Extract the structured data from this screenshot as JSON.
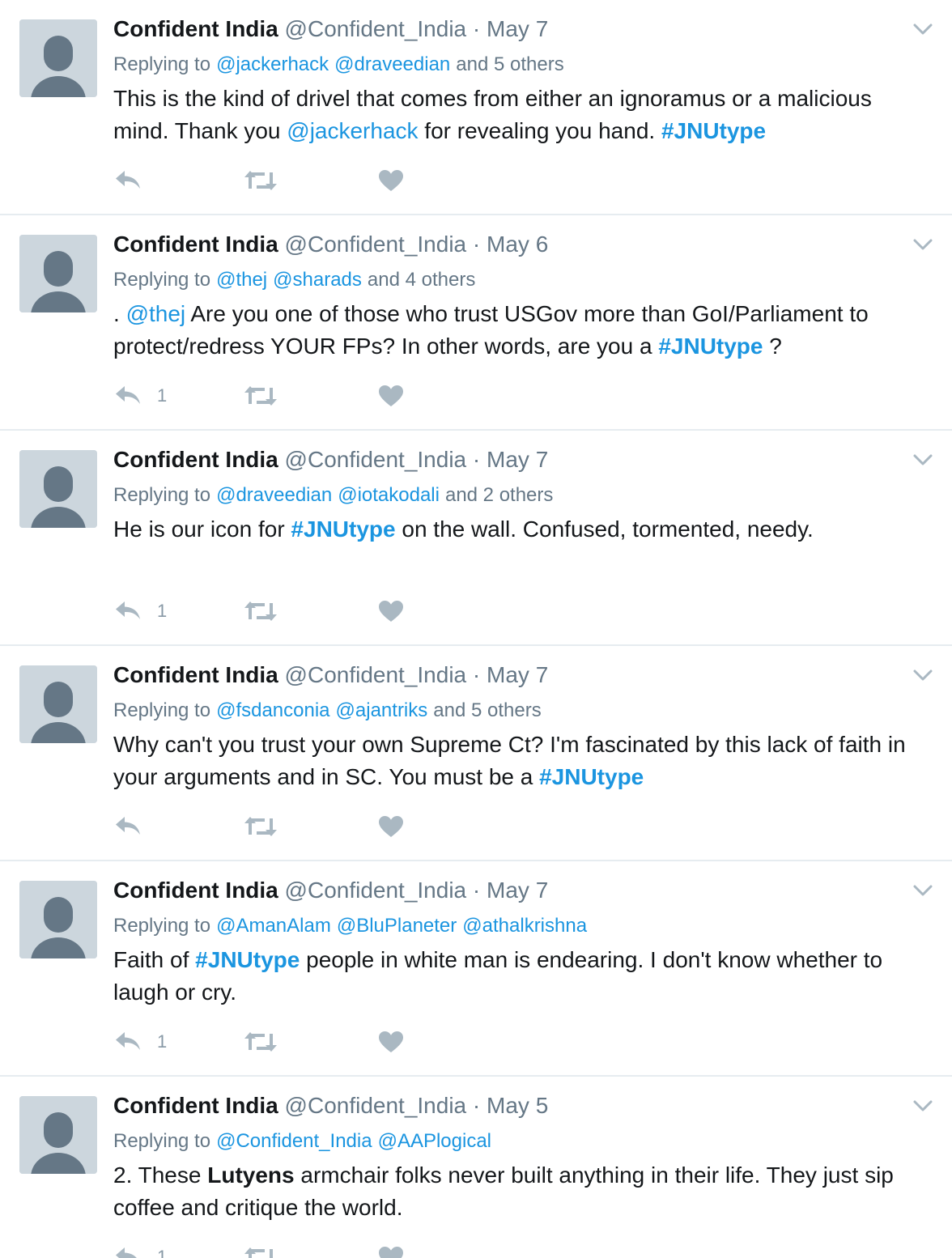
{
  "colors": {
    "link": "#1b95e0",
    "muted": "#657786",
    "icon": "#aab8c2",
    "avatar_bg": "#ccd6dd",
    "avatar_fg": "#657786"
  },
  "icons": {
    "avatar": "default-avatar-icon",
    "caret": "chevron-down-icon",
    "reply": "reply-icon",
    "retweet": "retweet-icon",
    "like": "heart-icon"
  },
  "tweets": [
    {
      "name": "Confident India",
      "handle": "@Confident_India",
      "sep": "·",
      "date": "May 7",
      "reply_prefix": "Replying to",
      "reply_mentions": [
        "@jackerhack",
        "@draveedian"
      ],
      "reply_others": "and 5 others",
      "text": [
        {
          "t": "text",
          "v": "This is the kind of drivel that comes from either an ignoramus or a malicious mind. Thank you "
        },
        {
          "t": "mention",
          "v": "@jackerhack"
        },
        {
          "t": "text",
          "v": " for revealing you hand. "
        },
        {
          "t": "hashtag",
          "v": "#JNUtype"
        }
      ],
      "reply_count": ""
    },
    {
      "name": "Confident India",
      "handle": "@Confident_India",
      "sep": "·",
      "date": "May 6",
      "reply_prefix": "Replying to",
      "reply_mentions": [
        "@thej",
        "@sharads"
      ],
      "reply_others": "and 4 others",
      "text": [
        {
          "t": "text",
          "v": ". "
        },
        {
          "t": "mention",
          "v": "@thej"
        },
        {
          "t": "text",
          "v": " Are you one of those who trust USGov more than GoI/Parliament to protect/redress YOUR FPs? In other words, are you a "
        },
        {
          "t": "hashtag",
          "v": "#JNUtype"
        },
        {
          "t": "text",
          "v": " ?"
        }
      ],
      "reply_count": "1"
    },
    {
      "name": "Confident India",
      "handle": "@Confident_India",
      "sep": "·",
      "date": "May 7",
      "reply_prefix": "Replying to",
      "reply_mentions": [
        "@draveedian",
        "@iotakodali"
      ],
      "reply_others": "and 2 others",
      "text": [
        {
          "t": "text",
          "v": "He is our icon for "
        },
        {
          "t": "hashtag",
          "v": "#JNUtype"
        },
        {
          "t": "text",
          "v": " on the wall. Confused, tormented, needy."
        }
      ],
      "reply_count": "1"
    },
    {
      "name": "Confident India",
      "handle": "@Confident_India",
      "sep": "·",
      "date": "May 7",
      "reply_prefix": "Replying to",
      "reply_mentions": [
        "@fsdanconia",
        "@ajantriks"
      ],
      "reply_others": "and 5 others",
      "text": [
        {
          "t": "text",
          "v": "Why can't you trust your own Supreme Ct? I'm fascinated by this lack of faith in your arguments and in SC. You must be a "
        },
        {
          "t": "hashtag",
          "v": "#JNUtype"
        }
      ],
      "reply_count": ""
    },
    {
      "name": "Confident India",
      "handle": "@Confident_India",
      "sep": "·",
      "date": "May 7",
      "reply_prefix": "Replying to",
      "reply_mentions": [
        "@AmanAlam",
        "@BluPlaneter",
        "@athalkrishna"
      ],
      "reply_others": "",
      "text": [
        {
          "t": "text",
          "v": "Faith of "
        },
        {
          "t": "hashtag",
          "v": "#JNUtype"
        },
        {
          "t": "text",
          "v": " people in white man is endearing. I don't know whether to laugh or cry."
        }
      ],
      "reply_count": "1"
    },
    {
      "name": "Confident India",
      "handle": "@Confident_India",
      "sep": "·",
      "date": "May 5",
      "reply_prefix": "Replying to",
      "reply_mentions": [
        "@Confident_India",
        "@AAPlogical"
      ],
      "reply_others": "",
      "text": [
        {
          "t": "text",
          "v": "2. These "
        },
        {
          "t": "bold",
          "v": "Lutyens"
        },
        {
          "t": "text",
          "v": " armchair folks never built anything in their life. They just sip coffee and critique the world."
        }
      ],
      "reply_count": "1"
    }
  ]
}
